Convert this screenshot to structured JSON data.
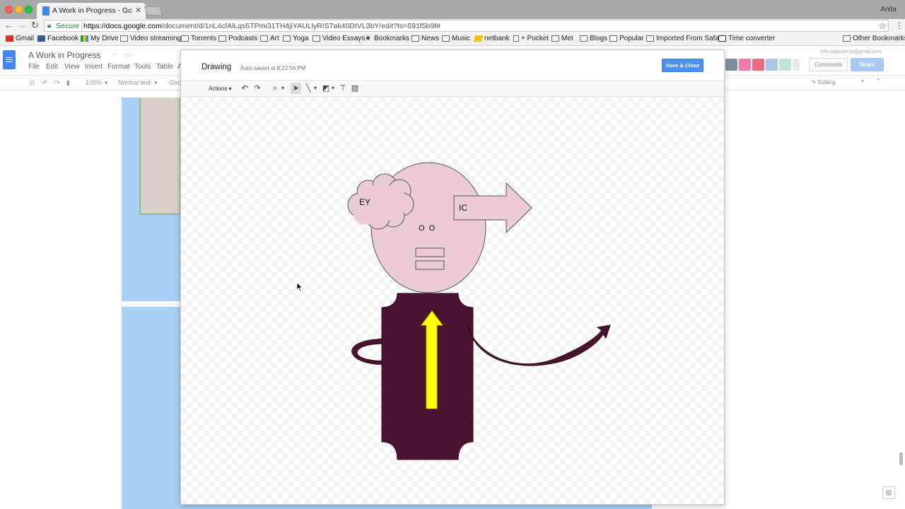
{
  "browser": {
    "tab_title": "A Work in Progress - Google D",
    "tab_close": "✕",
    "user_name": "Anita",
    "secure_label": "Secure",
    "url_host": "https://docs.google.com",
    "url_path": "/document/d/1nL4cfAlLqs5TPmi31TH4jiYAULlyRIS7ak40DtVL3bY/edit?ts=591f5b9f#",
    "bookmarks": [
      {
        "label": "Gmail",
        "icon": "gmail-icon"
      },
      {
        "label": "Facebook",
        "icon": "facebook-icon"
      },
      {
        "label": "My Drive",
        "icon": "drive-icon"
      },
      {
        "label": "Video streaming",
        "icon": "folder-icon"
      },
      {
        "label": "Torrents",
        "icon": "folder-icon"
      },
      {
        "label": "Podcasts",
        "icon": "folder-icon"
      },
      {
        "label": "Art",
        "icon": "folder-icon"
      },
      {
        "label": "Yoga",
        "icon": "folder-icon"
      },
      {
        "label": "Video Essays",
        "icon": "folder-icon"
      },
      {
        "label": "Bookmarks",
        "icon": "star-icon"
      },
      {
        "label": "News",
        "icon": "folder-icon"
      },
      {
        "label": "Music",
        "icon": "folder-icon"
      },
      {
        "label": "netbank",
        "icon": "bank-icon"
      },
      {
        "label": "+ Pocket",
        "icon": "page-icon"
      },
      {
        "label": "Met",
        "icon": "folder-icon"
      },
      {
        "label": "Blogs",
        "icon": "folder-icon"
      },
      {
        "label": "Popular",
        "icon": "folder-icon"
      },
      {
        "label": "Imported From Safari",
        "icon": "folder-icon"
      },
      {
        "label": "Time converter",
        "icon": "clock-icon"
      }
    ],
    "other_bookmarks": "Other Bookmarks"
  },
  "docs": {
    "title": "A Work in Progress",
    "menus": [
      "File",
      "Edit",
      "View",
      "Insert",
      "Format",
      "Tools",
      "Table",
      "A"
    ],
    "zoom": "100%",
    "style": "Normal text",
    "font": "Geor",
    "user_email": "intervalprojects@gmail.com",
    "comments_label": "Comments",
    "share_label": "Share",
    "mode_label": "Editing"
  },
  "drawing": {
    "title": "Drawing",
    "autosave": "Auto-saved at 8:22:56 PM",
    "save_close": "Save & Close",
    "actions_label": "Actions",
    "cloud_text": "EY",
    "arrow_text": "IC",
    "eyes_text": "O  O",
    "colors": {
      "head": "#ebcbd8",
      "body": "#4a1430",
      "tie": "#ffff00",
      "outline": "#555555",
      "accent_blue": "#4d8ff2"
    }
  }
}
